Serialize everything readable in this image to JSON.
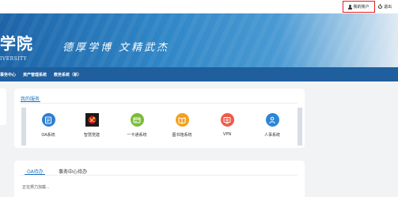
{
  "topbar": {
    "account_label": "我的账户",
    "logout_label": "退出",
    "account_icon": "user-icon",
    "logout_icon": "power-icon",
    "highlight_color": "#e02020"
  },
  "banner": {
    "school_cn": "学院",
    "school_en": "IVERSITY",
    "motto": "德厚学博 文精武杰"
  },
  "nav": {
    "items": [
      {
        "label": "事务中心"
      },
      {
        "label": "资产管理系统"
      },
      {
        "label": "教务系统（新）"
      }
    ]
  },
  "services": {
    "title": "我的服务",
    "items": [
      {
        "label": "OA系统",
        "icon": "id-card-icon",
        "color": "#2d7fd1"
      },
      {
        "label": "智慧党建",
        "icon": "party-emblem-icon",
        "color": "#c81e1e"
      },
      {
        "label": "一卡通系统",
        "icon": "card-icon",
        "color": "#7cbc3a"
      },
      {
        "label": "图书馆系统",
        "icon": "book-icon",
        "color": "#f3a01c"
      },
      {
        "label": "VPN",
        "icon": "vpn-icon",
        "color": "#ef5a4a"
      },
      {
        "label": "人事系统",
        "icon": "people-icon",
        "color": "#2b86d6"
      }
    ]
  },
  "todo": {
    "tabs": [
      {
        "label": "OA待办"
      },
      {
        "label": "事务中心待办"
      }
    ],
    "loading_text": "正在努力加载..."
  }
}
